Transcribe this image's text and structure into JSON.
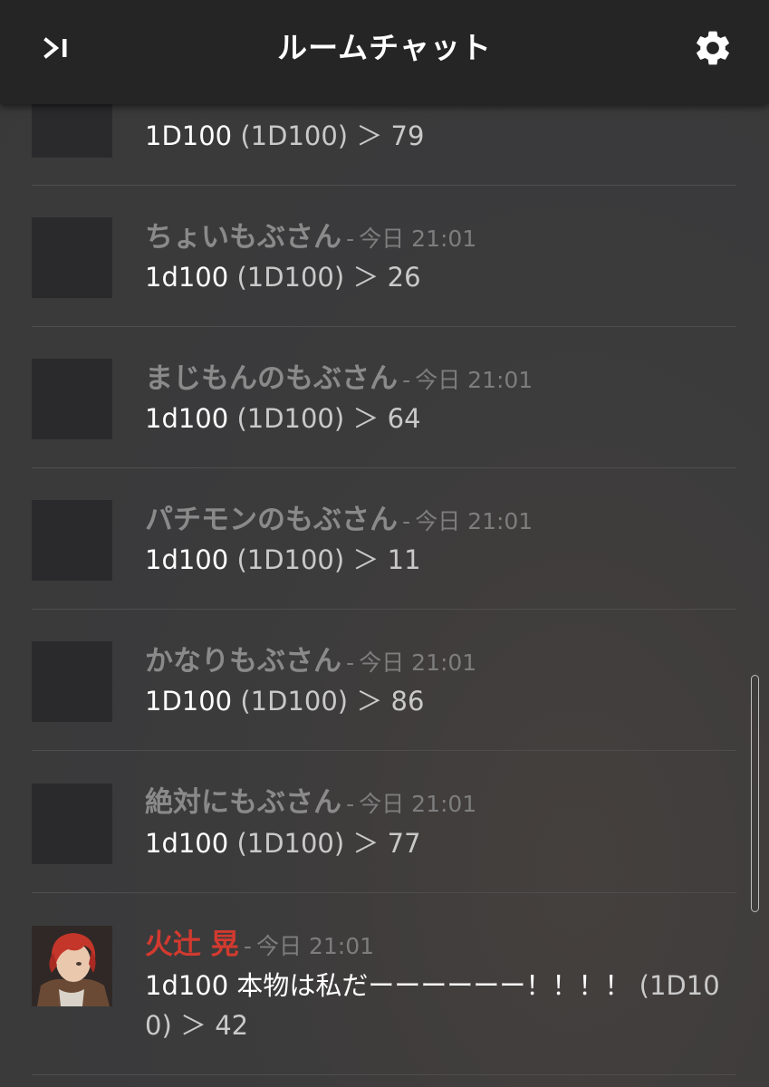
{
  "header": {
    "title": "ルームチャット",
    "collapse_icon": "panel-collapse-icon",
    "settings_icon": "gear-icon"
  },
  "messages": [
    {
      "name": "",
      "time": "",
      "command": "1D100 ",
      "result": "(1D100) ＞ 79",
      "partial": true
    },
    {
      "name": "ちょいもぶさん",
      "sep": "-",
      "time": "今日 21:01",
      "command": "1d100",
      "result": "(1D100) ＞ 26"
    },
    {
      "name": "まじもんのもぶさん",
      "sep": "-",
      "time": "今日 21:01",
      "command": "1d100",
      "result": "(1D100) ＞ 64"
    },
    {
      "name": "パチモンのもぶさん",
      "sep": "-",
      "time": "今日 21:01",
      "command": "1d100",
      "result": "(1D100) ＞ 11"
    },
    {
      "name": "かなりもぶさん",
      "sep": "-",
      "time": "今日 21:01",
      "command": "1D100 ",
      "result": "(1D100) ＞ 86"
    },
    {
      "name": "絶対にもぶさん",
      "sep": "-",
      "time": "今日 21:01",
      "command": "1d100",
      "result": "(1D100) ＞ 77"
    },
    {
      "name": "火辻 晃",
      "sep": "-",
      "time": "今日 21:01",
      "command": "1d100 本物は私だーーーーーー！！！！",
      "result": "(1D100) ＞ 42",
      "name_color": "#d33a2f"
    }
  ],
  "colors": {
    "header_bg": "#252525",
    "page_bg": "#3a3a3b",
    "accent_name": "#d33a2f"
  }
}
